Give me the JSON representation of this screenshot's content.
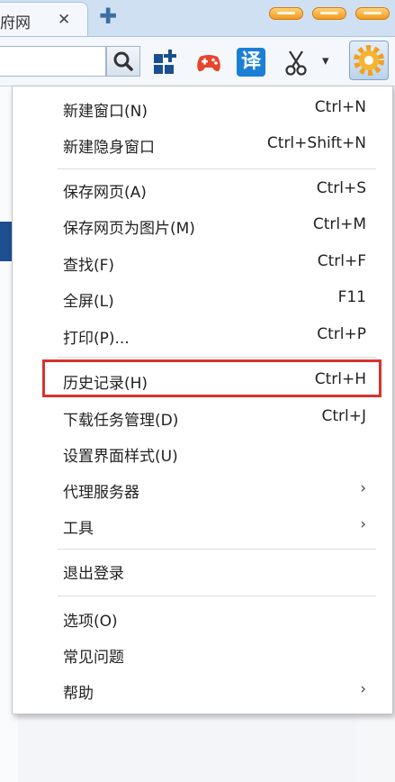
{
  "tab": {
    "title": "府网",
    "close": "✕",
    "new_tab": "✚"
  },
  "menu": {
    "items": [
      {
        "label": "新建窗口(N)",
        "shortcut": "Ctrl+N"
      },
      {
        "label": "新建隐身窗口",
        "shortcut": "Ctrl+Shift+N"
      },
      {
        "label": "保存网页(A)",
        "shortcut": "Ctrl+S"
      },
      {
        "label": "保存网页为图片(M)",
        "shortcut": "Ctrl+M"
      },
      {
        "label": "查找(F)",
        "shortcut": "Ctrl+F"
      },
      {
        "label": "全屏(L)",
        "shortcut": "F11"
      },
      {
        "label": "打印(P)...",
        "shortcut": "Ctrl+P"
      },
      {
        "label": "历史记录(H)",
        "shortcut": "Ctrl+H"
      },
      {
        "label": "下载任务管理(D)",
        "shortcut": "Ctrl+J"
      },
      {
        "label": "设置界面样式(U)",
        "shortcut": ""
      },
      {
        "label": "代理服务器",
        "arrow": "›"
      },
      {
        "label": "工具",
        "arrow": "›"
      },
      {
        "label": "退出登录",
        "shortcut": ""
      },
      {
        "label": "选项(O)",
        "shortcut": ""
      },
      {
        "label": "常见问题",
        "shortcut": ""
      },
      {
        "label": "帮助",
        "arrow": "›"
      }
    ]
  },
  "toolbar": {
    "translate_glyph": "译",
    "dropdown": "▾"
  },
  "colors": {
    "highlight_border": "#d8322f",
    "accent_blue": "#1d4f91",
    "window_button": "#f39a1e"
  }
}
